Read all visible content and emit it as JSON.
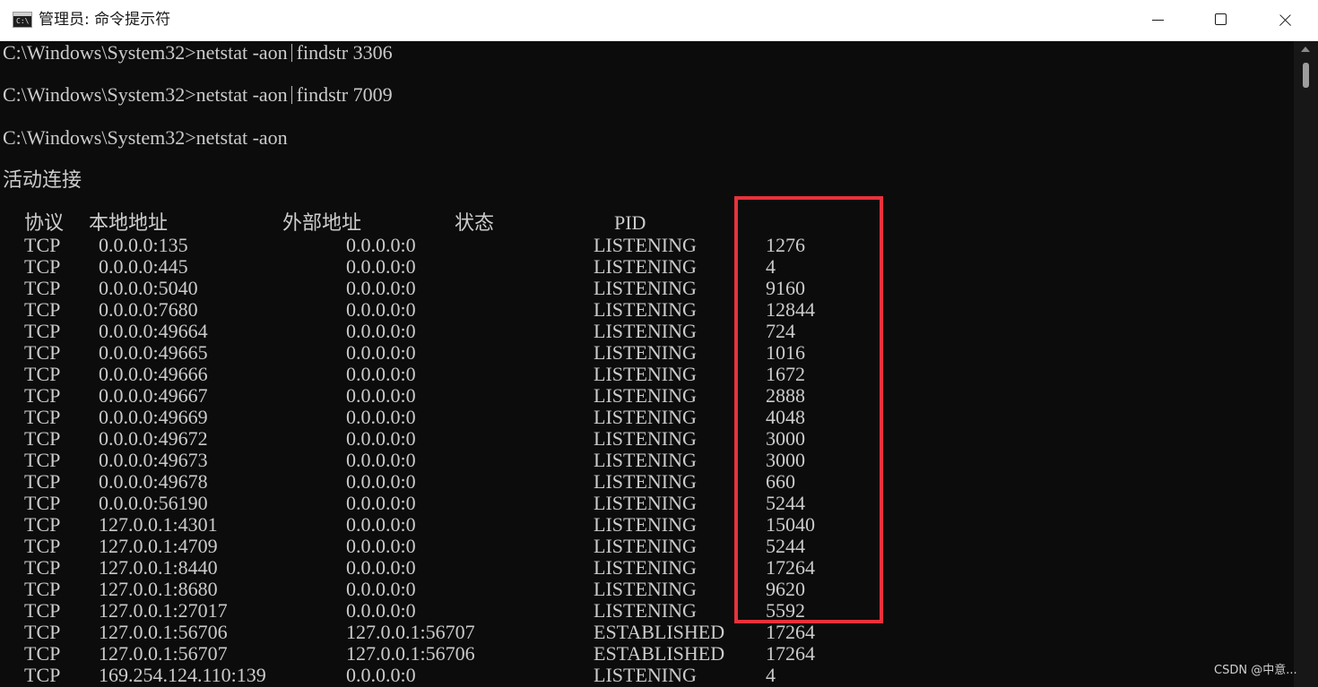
{
  "window": {
    "title": "管理员: 命令提示符",
    "app_icon_text": "C:\\",
    "buttons": [
      "minimize",
      "maximize",
      "close"
    ]
  },
  "console": {
    "lines": [
      {
        "prompt": "C:\\Windows\\System32>netstat -aon",
        "pipe": true,
        "rest": "findstr 3306"
      },
      {
        "prompt": "C:\\Windows\\System32>netstat -aon",
        "pipe": true,
        "rest": "findstr 7009"
      },
      {
        "prompt": "C:\\Windows\\System32>netstat -aon",
        "pipe": false,
        "rest": ""
      }
    ],
    "section_title": "活动连接",
    "headers": {
      "proto": "协议",
      "local": "本地地址",
      "foreign": "外部地址",
      "state": "状态",
      "pid": "PID"
    },
    "rows": [
      [
        "TCP",
        "0.0.0.0:135",
        "0.0.0.0:0",
        "LISTENING",
        "1276"
      ],
      [
        "TCP",
        "0.0.0.0:445",
        "0.0.0.0:0",
        "LISTENING",
        "4"
      ],
      [
        "TCP",
        "0.0.0.0:5040",
        "0.0.0.0:0",
        "LISTENING",
        "9160"
      ],
      [
        "TCP",
        "0.0.0.0:7680",
        "0.0.0.0:0",
        "LISTENING",
        "12844"
      ],
      [
        "TCP",
        "0.0.0.0:49664",
        "0.0.0.0:0",
        "LISTENING",
        "724"
      ],
      [
        "TCP",
        "0.0.0.0:49665",
        "0.0.0.0:0",
        "LISTENING",
        "1016"
      ],
      [
        "TCP",
        "0.0.0.0:49666",
        "0.0.0.0:0",
        "LISTENING",
        "1672"
      ],
      [
        "TCP",
        "0.0.0.0:49667",
        "0.0.0.0:0",
        "LISTENING",
        "2888"
      ],
      [
        "TCP",
        "0.0.0.0:49669",
        "0.0.0.0:0",
        "LISTENING",
        "4048"
      ],
      [
        "TCP",
        "0.0.0.0:49672",
        "0.0.0.0:0",
        "LISTENING",
        "3000"
      ],
      [
        "TCP",
        "0.0.0.0:49673",
        "0.0.0.0:0",
        "LISTENING",
        "3000"
      ],
      [
        "TCP",
        "0.0.0.0:49678",
        "0.0.0.0:0",
        "LISTENING",
        "660"
      ],
      [
        "TCP",
        "0.0.0.0:56190",
        "0.0.0.0:0",
        "LISTENING",
        "5244"
      ],
      [
        "TCP",
        "127.0.0.1:4301",
        "0.0.0.0:0",
        "LISTENING",
        "15040"
      ],
      [
        "TCP",
        "127.0.0.1:4709",
        "0.0.0.0:0",
        "LISTENING",
        "5244"
      ],
      [
        "TCP",
        "127.0.0.1:8440",
        "0.0.0.0:0",
        "LISTENING",
        "17264"
      ],
      [
        "TCP",
        "127.0.0.1:8680",
        "0.0.0.0:0",
        "LISTENING",
        "9620"
      ],
      [
        "TCP",
        "127.0.0.1:27017",
        "0.0.0.0:0",
        "LISTENING",
        "5592"
      ],
      [
        "TCP",
        "127.0.0.1:56706",
        "127.0.0.1:56707",
        "ESTABLISHED",
        "17264"
      ],
      [
        "TCP",
        "127.0.0.1:56707",
        "127.0.0.1:56706",
        "ESTABLISHED",
        "17264"
      ],
      [
        "TCP",
        "169.254.124.110:139",
        "0.0.0.0:0",
        "LISTENING",
        "4"
      ]
    ]
  },
  "annotation": {
    "color": "#e8323c"
  },
  "watermark": "CSDN @中意..."
}
